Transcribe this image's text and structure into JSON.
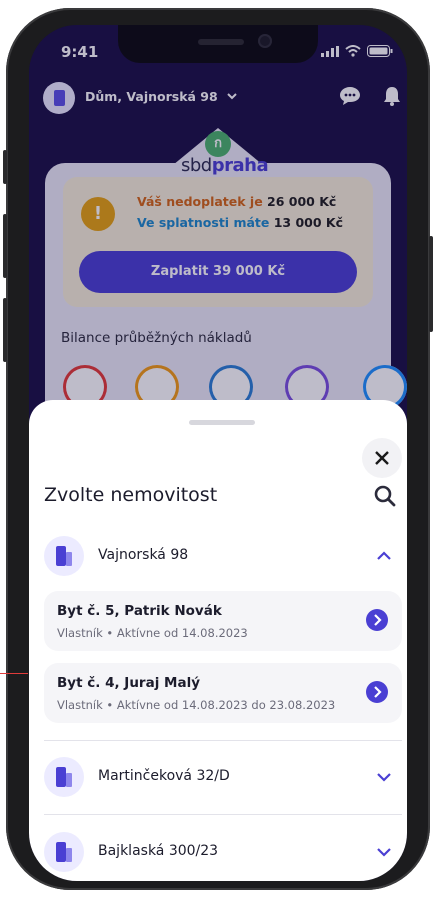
{
  "status": {
    "time": "9:41"
  },
  "header": {
    "property": "Dům, Vajnorská 98",
    "chevron": "chevron-down-icon",
    "chat_icon": "chat-icon",
    "bell_icon": "bell-icon"
  },
  "logo": {
    "prefix": "sbd",
    "brand": "praha"
  },
  "alert": {
    "line1_text": "Váš nedoplatek je ",
    "line1_amount": "26 000 Kč",
    "line2_text": "Ve splatnosti máte ",
    "line2_amount": "13 000 Kč",
    "pay_button": "Zaplatit 39 000 Kč"
  },
  "balance": {
    "title": "Bilance průběžných nákladů",
    "gauges": [
      {
        "icon": "lightning-icon",
        "color": "#e53935"
      },
      {
        "icon": "sun-icon",
        "color": "#f39c12"
      },
      {
        "icon": "bath-icon",
        "color": "#2a7fd4"
      },
      {
        "icon": "flame-icon",
        "color": "#7b4fe0"
      },
      {
        "icon": "faucet-icon",
        "color": "#1e90ff"
      }
    ]
  },
  "sheet": {
    "title": "Zvolte nemovitost",
    "properties": [
      {
        "name": "Vajnorská 98",
        "expanded": true,
        "units": [
          {
            "title": "Byt č. 5, Patrik Novák",
            "subtitle": "Vlastník • Aktívne od 14.08.2023"
          },
          {
            "title": "Byt č. 4, Juraj Malý",
            "subtitle": "Vlastník • Aktívne od 14.08.2023 do 23.08.2023"
          }
        ]
      },
      {
        "name": "Martinčeková 32/D",
        "expanded": false
      },
      {
        "name": "Bajklaská 300/23",
        "expanded": false
      }
    ]
  },
  "colors": {
    "accent": "#4a3fd3",
    "dark_bg": "#1a1045",
    "warning": "#e6a20f"
  }
}
